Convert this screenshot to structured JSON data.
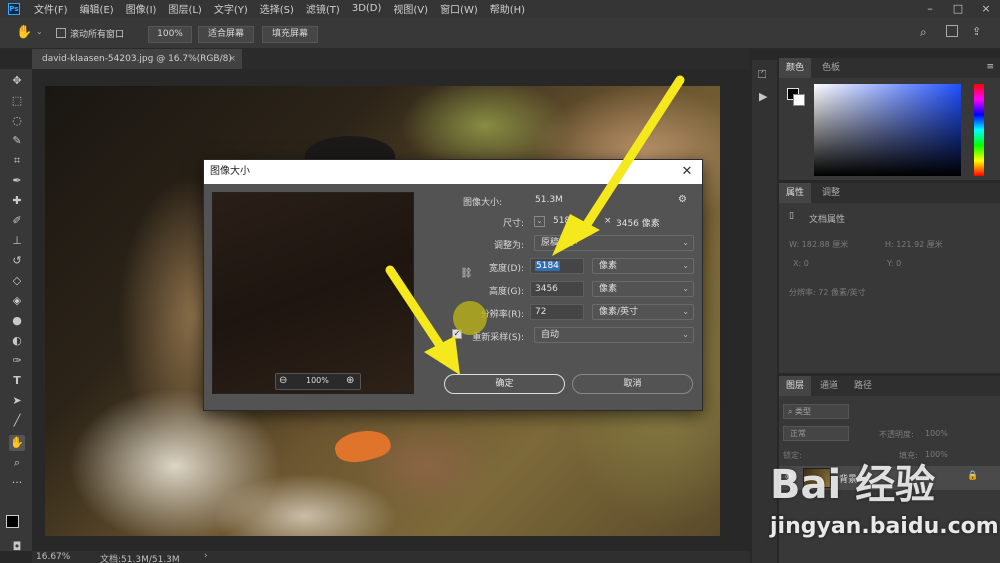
{
  "menubar": {
    "logo": "Ps",
    "items": [
      "文件(F)",
      "编辑(E)",
      "图像(I)",
      "图层(L)",
      "文字(Y)",
      "选择(S)",
      "滤镜(T)",
      "3D(D)",
      "视图(V)",
      "窗口(W)",
      "帮助(H)"
    ]
  },
  "options": {
    "scroll_all": "滚动所有窗口",
    "zoom_pct": "100%",
    "fit_screen": "适合屏幕",
    "fill_screen": "填充屏幕"
  },
  "document": {
    "tab_title": "david-klaasen-54203.jpg @ 16.7%(RGB/8)",
    "tab_close": "×"
  },
  "status": {
    "zoom": "16.67%",
    "doc_info": "文档:51.3M/51.3M"
  },
  "panels": {
    "color_tabs": [
      "颜色",
      "色板"
    ],
    "props_tabs": [
      "属性",
      "调整"
    ],
    "props_title": "文档属性",
    "props_w": "W:  182.88 厘米",
    "props_h": "H:  121.92 厘米",
    "props_x": "X:  0",
    "props_y": "Y:  0",
    "props_res": "分辨率: 72 像素/英寸",
    "layers_tabs": [
      "图层",
      "通道",
      "路径"
    ],
    "layers_kind": "类型",
    "layers_mode": "正常",
    "layers_opacity_label": "不透明度:",
    "layers_opacity": "100%",
    "layers_lock": "锁定:",
    "layers_fill_label": "填充:",
    "layers_fill": "100%",
    "layer_name": "背景"
  },
  "dialog": {
    "title": "图像大小",
    "image_size_label": "图像大小:",
    "image_size_value": "51.3M",
    "dimensions_label": "尺寸:",
    "dimensions_w": "5184",
    "dimensions_unit_x": "×",
    "dimensions_h": "3456 像素",
    "fit_to_label": "调整为:",
    "fit_to_value": "原稿大小",
    "width_label": "宽度(D):",
    "width_value": "5184",
    "width_unit": "像素",
    "height_label": "高度(G):",
    "height_value": "3456",
    "height_unit": "像素",
    "resolution_label": "分辨率(R):",
    "resolution_value": "72",
    "resolution_unit": "像素/英寸",
    "resample_label": "重新采样(S):",
    "resample_value": "自动",
    "preview_zoom": "100%",
    "ok": "确定",
    "cancel": "取消"
  },
  "watermark": {
    "logo": "Bai 经验",
    "url": "jingyan.baidu.com"
  },
  "colors": {
    "arrow": "#f5e81c",
    "accent_blue": "#31a8ff",
    "selection": "#2f6db5"
  }
}
